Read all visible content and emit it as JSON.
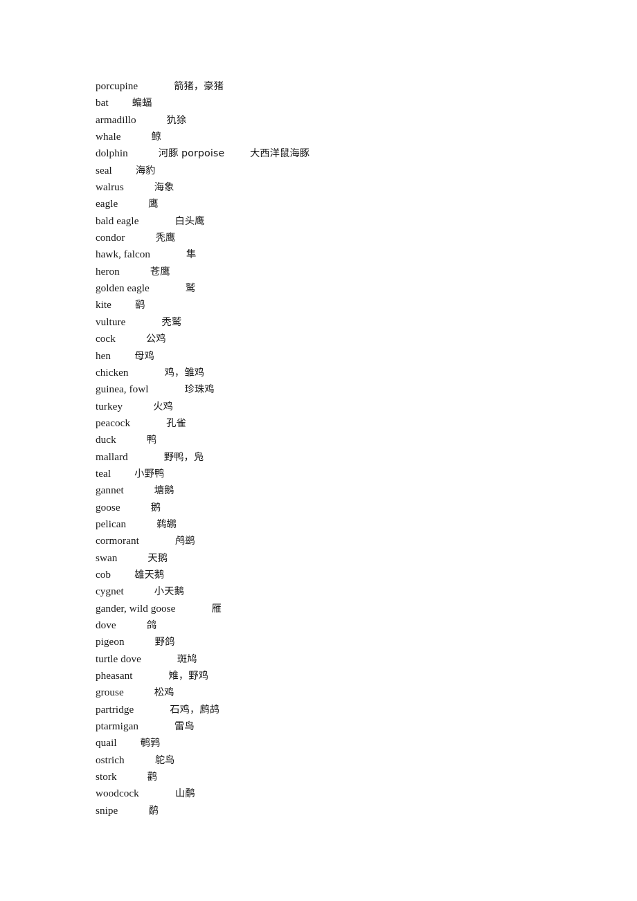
{
  "document": {
    "type": "bilingual-vocabulary-list",
    "language_pair": "English-Chinese",
    "background_color": "#ffffff",
    "text_color": "#181818"
  },
  "entries": [
    {
      "term": "porcupine",
      "gap": 52,
      "gloss": "箭猪，豪猪"
    },
    {
      "term": "bat",
      "gap": 34,
      "gloss": "蝙蝠"
    },
    {
      "term": "armadillo",
      "gap": 44,
      "gloss": "犰狳"
    },
    {
      "term": "whale",
      "gap": 44,
      "gloss": "鲸"
    },
    {
      "term": "dolphin",
      "gap": 44,
      "gloss": "河豚 porpoise        大西洋鼠海豚"
    },
    {
      "term": "seal",
      "gap": 34,
      "gloss": "海豹"
    },
    {
      "term": "walrus",
      "gap": 44,
      "gloss": "海象"
    },
    {
      "term": "eagle",
      "gap": 44,
      "gloss": "鹰"
    },
    {
      "term": "bald eagle",
      "gap": 52,
      "gloss": "白头鹰"
    },
    {
      "term": "condor",
      "gap": 44,
      "gloss": "秃鹰"
    },
    {
      "term": "hawk, falcon",
      "gap": 52,
      "gloss": "隼"
    },
    {
      "term": "heron",
      "gap": 44,
      "gloss": "苍鹰"
    },
    {
      "term": "golden eagle",
      "gap": 52,
      "gloss": "鹫"
    },
    {
      "term": "kite",
      "gap": 34,
      "gloss": "鹞"
    },
    {
      "term": "vulture",
      "gap": 52,
      "gloss": "秃鹫"
    },
    {
      "term": "cock",
      "gap": 44,
      "gloss": "公鸡"
    },
    {
      "term": "hen",
      "gap": 34,
      "gloss": "母鸡"
    },
    {
      "term": "chicken",
      "gap": 52,
      "gloss": "鸡，雏鸡"
    },
    {
      "term": "guinea, fowl",
      "gap": 52,
      "gloss": "珍珠鸡"
    },
    {
      "term": "turkey",
      "gap": 44,
      "gloss": "火鸡"
    },
    {
      "term": "peacock",
      "gap": 52,
      "gloss": "孔雀"
    },
    {
      "term": "duck",
      "gap": 44,
      "gloss": "鸭"
    },
    {
      "term": "mallard",
      "gap": 52,
      "gloss": "野鸭，凫"
    },
    {
      "term": "teal",
      "gap": 34,
      "gloss": "小野鸭"
    },
    {
      "term": "gannet",
      "gap": 44,
      "gloss": "塘鹅"
    },
    {
      "term": "goose",
      "gap": 44,
      "gloss": "鹅"
    },
    {
      "term": "pelican",
      "gap": 44,
      "gloss": "鹈鹕"
    },
    {
      "term": "cormorant",
      "gap": 52,
      "gloss": "鸬鹚"
    },
    {
      "term": "swan",
      "gap": 44,
      "gloss": "天鹅"
    },
    {
      "term": "cob",
      "gap": 34,
      "gloss": "雄天鹅"
    },
    {
      "term": "cygnet",
      "gap": 44,
      "gloss": "小天鹅"
    },
    {
      "term": "gander, wild goose",
      "gap": 52,
      "gloss": "雁"
    },
    {
      "term": "dove",
      "gap": 44,
      "gloss": "鸽"
    },
    {
      "term": "pigeon",
      "gap": 44,
      "gloss": "野鸽"
    },
    {
      "term": "turtle dove",
      "gap": 52,
      "gloss": "斑鸠"
    },
    {
      "term": "pheasant",
      "gap": 52,
      "gloss": "雉，野鸡"
    },
    {
      "term": "grouse",
      "gap": 44,
      "gloss": "松鸡"
    },
    {
      "term": "partridge",
      "gap": 52,
      "gloss": "石鸡，鹧鸪"
    },
    {
      "term": "ptarmigan",
      "gap": 52,
      "gloss": "雷鸟"
    },
    {
      "term": "quail",
      "gap": 34,
      "gloss": "鹌鹑"
    },
    {
      "term": "ostrich",
      "gap": 44,
      "gloss": "鸵鸟"
    },
    {
      "term": "stork",
      "gap": 44,
      "gloss": "鹳"
    },
    {
      "term": "woodcock",
      "gap": 52,
      "gloss": "山鹬"
    },
    {
      "term": "snipe",
      "gap": 44,
      "gloss": "鹬"
    }
  ]
}
